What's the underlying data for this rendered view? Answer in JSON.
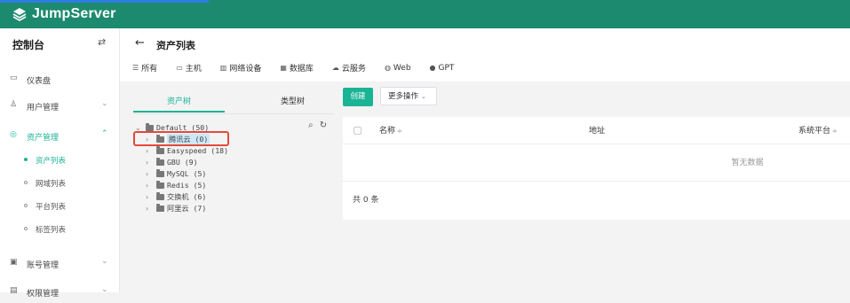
{
  "app": {
    "name": "JumpServer"
  },
  "sidebar": {
    "title": "控制台",
    "toggle": "⇄",
    "items": [
      {
        "label": "仪表盘",
        "icon": "dashboard-icon",
        "glyph": "▭",
        "arrow": ""
      },
      {
        "label": "用户管理",
        "icon": "users-icon",
        "glyph": "♙",
        "arrow": "⌄"
      },
      {
        "label": "资产管理",
        "icon": "assets-icon",
        "glyph": "◎",
        "arrow": "⌃"
      },
      {
        "label": "账号管理",
        "icon": "accounts-icon",
        "glyph": "▣",
        "arrow": "⌄"
      },
      {
        "label": "权限管理",
        "icon": "permissions-icon",
        "glyph": "▤",
        "arrow": "⌄"
      }
    ],
    "sub_items": [
      "资产列表",
      "网域列表",
      "平台列表",
      "标签列表"
    ]
  },
  "header": {
    "back": "←",
    "title": "资产列表",
    "tabs": [
      {
        "label": "所有",
        "glyph": "☰",
        "icon": "list-icon"
      },
      {
        "label": "主机",
        "glyph": "▭",
        "icon": "host-icon"
      },
      {
        "label": "网络设备",
        "glyph": "▥",
        "icon": "network-device-icon"
      },
      {
        "label": "数据库",
        "glyph": "▦",
        "icon": "database-icon"
      },
      {
        "label": "云服务",
        "glyph": "☁",
        "icon": "cloud-icon"
      },
      {
        "label": "Web",
        "glyph": "◍",
        "icon": "web-icon"
      },
      {
        "label": "GPT",
        "glyph": "●",
        "icon": "gpt-icon"
      }
    ]
  },
  "tree": {
    "tabs": [
      "资产树",
      "类型树"
    ],
    "tools": {
      "search": "⌕",
      "refresh": "↻"
    },
    "root": "Default (50)",
    "children": [
      {
        "label": "腾讯云 (0)",
        "selected": true
      },
      {
        "label": "Easyspeed (18)"
      },
      {
        "label": "GBU (9)"
      },
      {
        "label": "MySQL (5)"
      },
      {
        "label": "Redis (5)"
      },
      {
        "label": "交换机 (6)"
      },
      {
        "label": "阿里云 (7)"
      }
    ]
  },
  "toolbar": {
    "create": "创建",
    "more": "更多操作",
    "more_chev": "⌄"
  },
  "table": {
    "columns": [
      "名称",
      "地址",
      "系统平台"
    ],
    "sort_glyph": "≑",
    "empty": "暂无数据",
    "total": "共 0 条"
  },
  "colors": {
    "brand": "#1c8a6e",
    "accent": "#1ab394",
    "highlight": "#e24a3b"
  }
}
